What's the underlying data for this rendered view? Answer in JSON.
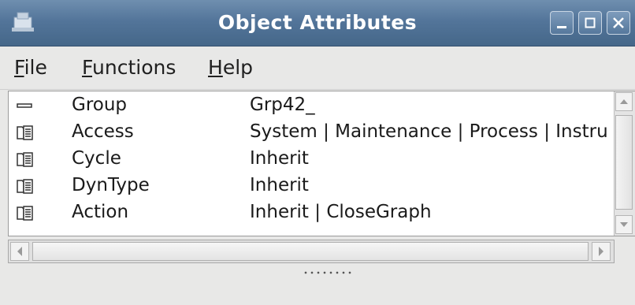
{
  "window": {
    "title": "Object Attributes",
    "buttons": [
      "minimize",
      "maximize",
      "close"
    ]
  },
  "menu": [
    {
      "mnemonic": "F",
      "rest": "ile"
    },
    {
      "mnemonic": "F",
      "rest": "unctions"
    },
    {
      "mnemonic": "H",
      "rest": "elp"
    }
  ],
  "attributes": [
    {
      "icon": "dash-icon",
      "name": "Group",
      "value": "Grp42_"
    },
    {
      "icon": "folder-list-icon",
      "name": "Access",
      "value": "System | Maintenance | Process | Instrument"
    },
    {
      "icon": "folder-list-icon",
      "name": "Cycle",
      "value": "Inherit"
    },
    {
      "icon": "folder-list-icon",
      "name": "DynType",
      "value": "Inherit"
    },
    {
      "icon": "folder-list-icon",
      "name": "Action",
      "value": "Inherit | CloseGraph"
    }
  ],
  "colors": {
    "titlebar": "#53759a",
    "title_text": "#ffffff",
    "background": "#e8e8e7",
    "list_background": "#ffffff"
  }
}
